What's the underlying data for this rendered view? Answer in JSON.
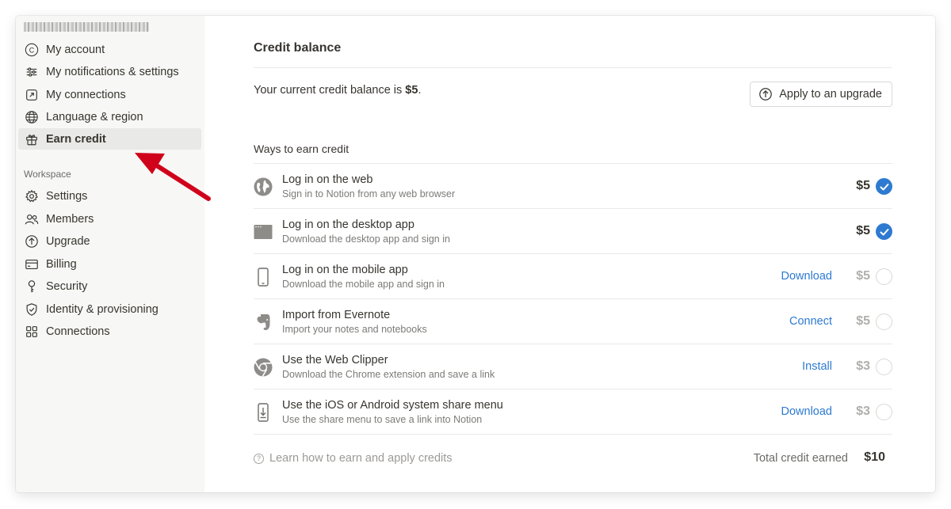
{
  "sidebar": {
    "account_items": [
      {
        "label": "My account",
        "icon": "account-c-icon"
      },
      {
        "label": "My notifications & settings",
        "icon": "sliders-icon"
      },
      {
        "label": "My connections",
        "icon": "external-link-icon"
      },
      {
        "label": "Language & region",
        "icon": "globe-icon"
      },
      {
        "label": "Earn credit",
        "icon": "gift-icon"
      }
    ],
    "workspace_label": "Workspace",
    "workspace_items": [
      {
        "label": "Settings",
        "icon": "gear-icon"
      },
      {
        "label": "Members",
        "icon": "people-icon"
      },
      {
        "label": "Upgrade",
        "icon": "upgrade-arrow-icon"
      },
      {
        "label": "Billing",
        "icon": "credit-card-icon"
      },
      {
        "label": "Security",
        "icon": "key-icon"
      },
      {
        "label": "Identity & provisioning",
        "icon": "shield-check-icon"
      },
      {
        "label": "Connections",
        "icon": "grid-icon"
      }
    ]
  },
  "main": {
    "title": "Credit balance",
    "balance_prefix": "Your current credit balance is ",
    "balance_value": "$5",
    "balance_suffix": ".",
    "upgrade_button": "Apply to an upgrade",
    "ways_heading": "Ways to earn credit",
    "rows": [
      {
        "title": "Log in on the web",
        "subtitle": "Sign in to Notion from any web browser",
        "action": "",
        "amount": "$5",
        "done": true,
        "icon": "web-globe-icon"
      },
      {
        "title": "Log in on the desktop app",
        "subtitle": "Download the desktop app and sign in",
        "action": "",
        "amount": "$5",
        "done": true,
        "icon": "desktop-window-icon"
      },
      {
        "title": "Log in on the mobile app",
        "subtitle": "Download the mobile app and sign in",
        "action": "Download",
        "amount": "$5",
        "done": false,
        "icon": "phone-icon"
      },
      {
        "title": "Import from Evernote",
        "subtitle": "Import your notes and notebooks",
        "action": "Connect",
        "amount": "$5",
        "done": false,
        "icon": "evernote-icon"
      },
      {
        "title": "Use the Web Clipper",
        "subtitle": "Download the Chrome extension and save a link",
        "action": "Install",
        "amount": "$3",
        "done": false,
        "icon": "chrome-icon"
      },
      {
        "title": "Use the iOS or Android system share menu",
        "subtitle": "Use the share menu to save a link into Notion",
        "action": "Download",
        "amount": "$3",
        "done": false,
        "icon": "phone-share-icon"
      }
    ],
    "learn_link": "Learn how to earn and apply credits",
    "total_label": "Total credit earned",
    "total_value": "$10"
  },
  "colors": {
    "accent": "#2e7ad1",
    "sidebar_bg": "#f7f7f5",
    "arrow": "#d0021b"
  }
}
